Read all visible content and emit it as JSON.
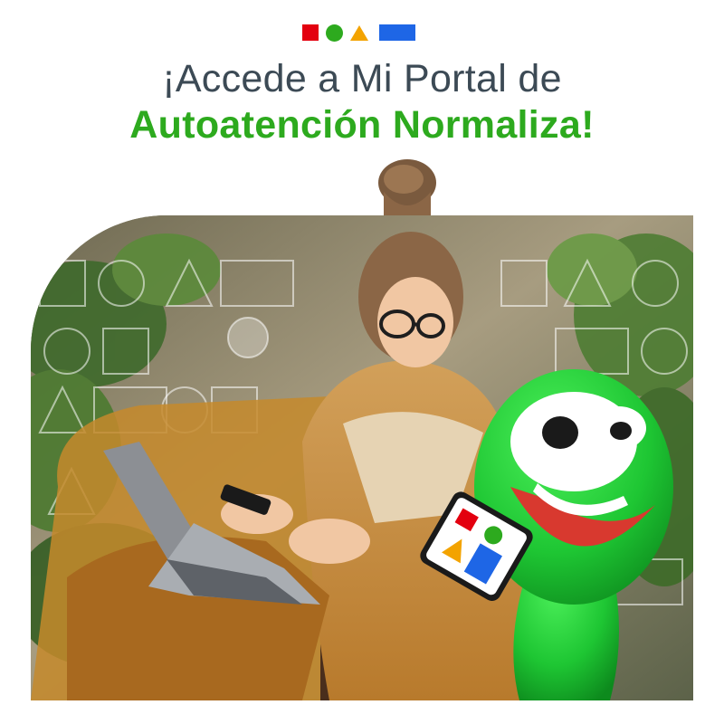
{
  "brand": {
    "shapes": [
      "red-square",
      "green-circle",
      "yellow-triangle",
      "blue-rectangle"
    ],
    "colors": {
      "red": "#e3000f",
      "green": "#2daa1e",
      "yellow": "#f3a300",
      "blue": "#1e66e6",
      "text_dark": "#3c4a55"
    }
  },
  "headline": {
    "line1": "¡Accede a Mi Portal de",
    "line2": "Autoatención Normaliza!"
  },
  "photo": {
    "subject": "woman-with-laptop-and-phone",
    "mascot": "green-mascot-holding-phone"
  }
}
